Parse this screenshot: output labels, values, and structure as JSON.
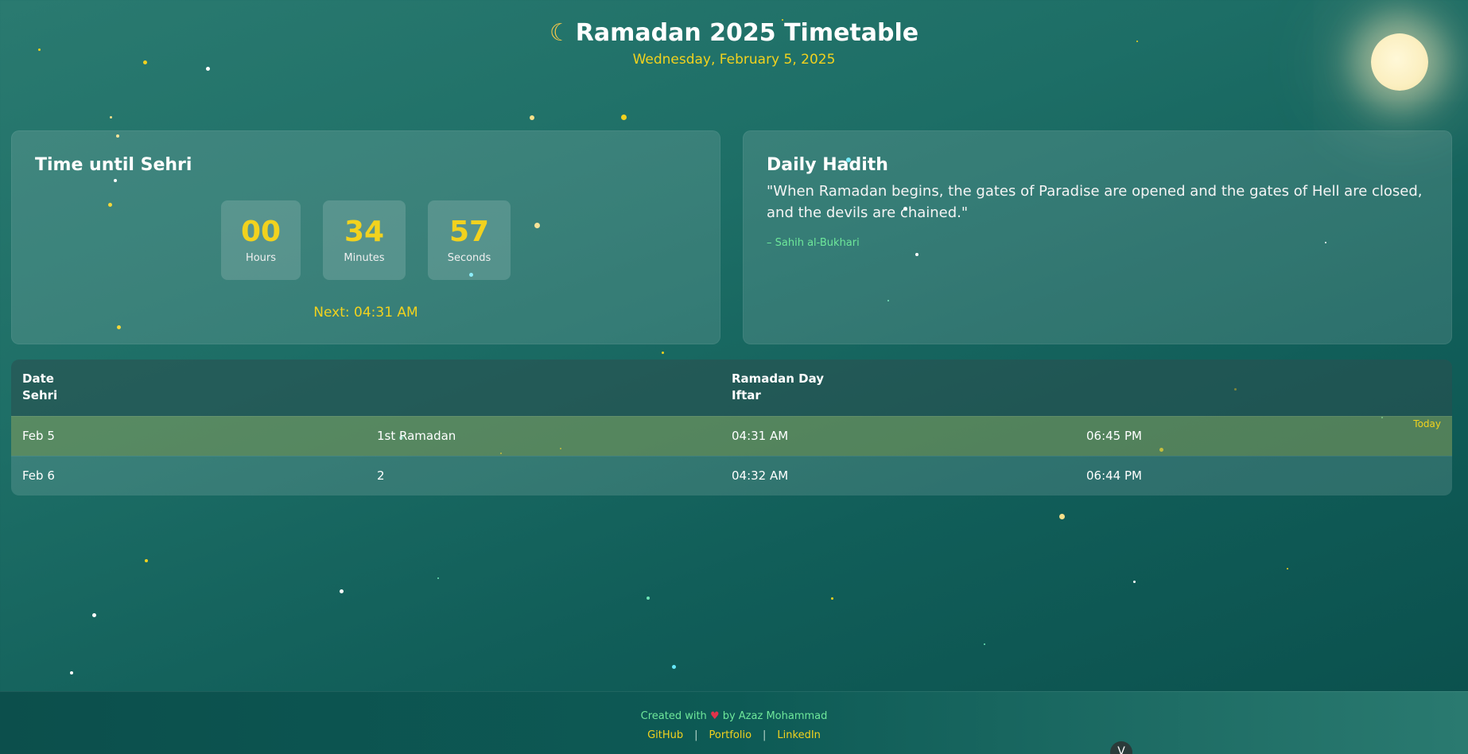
{
  "header": {
    "icon": "crescent-moon-icon",
    "title": "Ramadan 2025 Timetable",
    "date": "Wednesday, February 5, 2025"
  },
  "countdown": {
    "title": "Time until Sehri",
    "hours": "00",
    "hours_label": "Hours",
    "minutes": "34",
    "minutes_label": "Minutes",
    "seconds": "57",
    "seconds_label": "Seconds",
    "next": "Next: 04:31 AM"
  },
  "hadith": {
    "title": "Daily Hadith",
    "text": "\"When Ramadan begins, the gates of Paradise are opened and the gates of Hell are closed, and the devils are chained.\"",
    "source": "– Sahih al-Bukhari"
  },
  "table": {
    "headers": {
      "col1_line1": "Date",
      "col1_line2": "Sehri",
      "col3_line1": "Ramadan Day",
      "col3_line2": "Iftar"
    },
    "today_badge": "Today",
    "rows": [
      {
        "date": "Feb 5",
        "day": "1st Ramadan",
        "sehri": "04:31 AM",
        "iftar": "06:45 PM"
      },
      {
        "date": "Feb 6",
        "day": "2",
        "sehri": "04:32 AM",
        "iftar": "06:44 PM"
      }
    ]
  },
  "footer": {
    "created_prefix": "Created with",
    "created_suffix": "by Azaz Mohammad",
    "heart_icon": "heart-icon",
    "links": [
      "GitHub",
      "Portfolio",
      "LinkedIn"
    ],
    "separator": "|",
    "badge": "V"
  },
  "colors": {
    "accent_yellow": "#f2d21e",
    "accent_green": "#6ee79a",
    "heart_red": "#e0334b",
    "background": "#1d6e66"
  }
}
